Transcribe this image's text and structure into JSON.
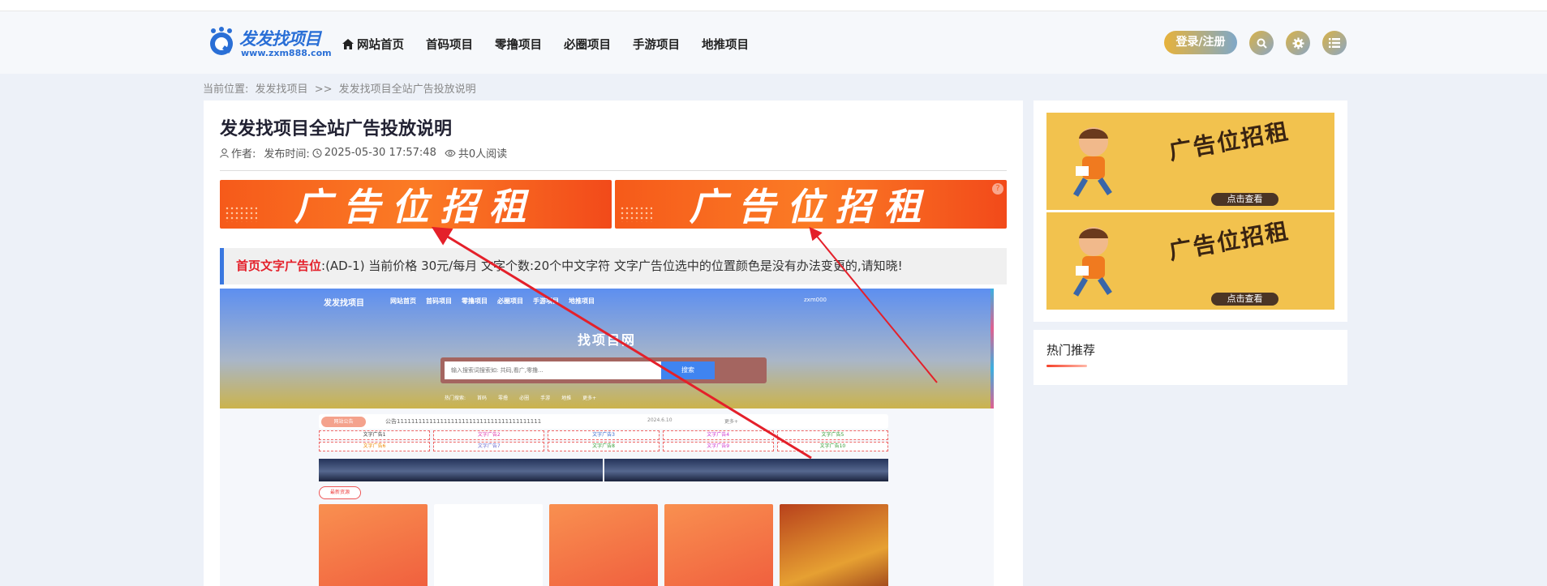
{
  "site": {
    "logo_text": "发发找项目",
    "logo_url": "www.zxm888.com"
  },
  "nav": [
    {
      "label": "网站首页",
      "icon": "home-icon"
    },
    {
      "label": "首码项目"
    },
    {
      "label": "零撸项目"
    },
    {
      "label": "必圈项目"
    },
    {
      "label": "手游项目"
    },
    {
      "label": "地推项目"
    }
  ],
  "header": {
    "login_label": "登录/注册",
    "icons": [
      "search-icon",
      "gear-icon",
      "list-icon"
    ]
  },
  "breadcrumb": {
    "prefix": "当前位置:",
    "home": "发发找项目",
    "sep": ">>",
    "current": "发发找项目全站广告投放说明"
  },
  "article": {
    "title": "发发找项目全站广告投放说明",
    "author_label": "作者:",
    "date_label": "发布时间:",
    "date": "2025-05-30 17:57:48",
    "reads": "共0人阅读"
  },
  "ad_banner_text": "广告位招租",
  "notice": {
    "label": "首页文字广告位",
    "text": ":(AD-1) 当前价格 30元/每月 文字个数:20个中文字符 文字广告位选中的位置颜色是没有办法变更的,请知晓!"
  },
  "screenshot": {
    "nav": [
      "网站首页",
      "首码项目",
      "零撸项目",
      "必圈项目",
      "手游项目",
      "地推项目"
    ],
    "logo_text": "发发找项目",
    "user": "zxm000",
    "hero_title": "找项目网",
    "search_placeholder": "输入搜索词搜索如: 共码,看广,零撸...",
    "search_button": "搜索",
    "hot_label": "热门搜索:",
    "hot_items": [
      "首码",
      "零撸",
      "必圈",
      "手游",
      "地推",
      "更多+"
    ],
    "notice_pill": "网站公告",
    "notice_text": "公告1111111111111111111111111111111111111111",
    "notice_date": "2024.6.10",
    "notice_more": "更多+",
    "text_ads": [
      "文字广告1",
      "文字广告2",
      "文字广告3",
      "文字广告4",
      "文字广告5",
      "文字广告6",
      "文字广告7",
      "文字广告8",
      "文字广告9",
      "文字广告10"
    ],
    "latest_label": "最新资源"
  },
  "sidebar": {
    "ad_title": "广告位招租",
    "ad_button": "点击查看",
    "hot_title": "热门推荐"
  },
  "colors": {
    "accent_blue": "#3a78e0",
    "accent_red": "#e4202a",
    "ad_orange": "#f65a1a",
    "side_ad_yellow": "#f2c24e"
  }
}
